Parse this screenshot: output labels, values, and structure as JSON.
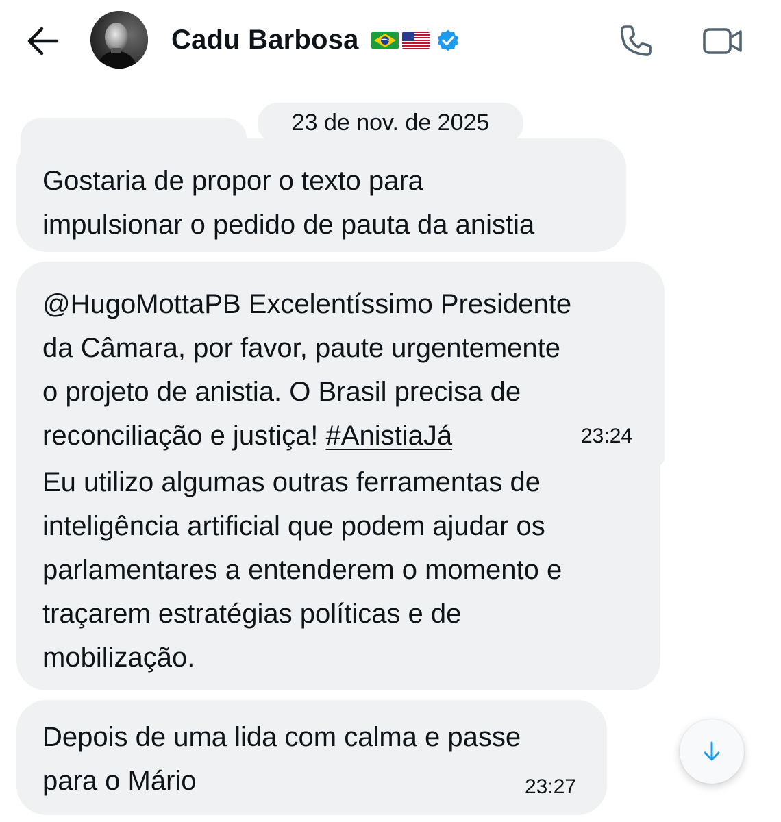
{
  "header": {
    "contact_name": "Cadu Barbosa",
    "flags": [
      "brazil-flag",
      "usa-flag"
    ],
    "verified_badge": "verified-icon",
    "icons": {
      "back": "arrow-left-icon",
      "call": "phone-icon",
      "video": "video-camera-icon"
    }
  },
  "conversation": {
    "date_separator": "23 de nov. de 2025",
    "messages": [
      {
        "lines": [
          "Gostaria de propor o texto para",
          "impulsionar o pedido de pauta da anistia"
        ]
      },
      {
        "mention": "@HugoMottaPB",
        "lines": [
          " Excelentíssimo Presidente",
          "da Câmara, por favor, paute urgentemente",
          "o projeto de anistia. O Brasil precisa de",
          "reconciliação e justiça! "
        ],
        "hashtag": "#AnistiaJá",
        "time": "23:24"
      },
      {
        "lines": [
          "Eu utilizo algumas outras ferramentas de",
          "inteligência artificial que podem ajudar os",
          "parlamentares a entenderem o momento e",
          "traçarem estratégias políticas e de",
          "mobilização."
        ]
      },
      {
        "lines": [
          "Depois de uma lida com calma e passe",
          "para o Mário"
        ],
        "time": "23:27"
      }
    ]
  },
  "scroll_button": {
    "icon": "arrow-down-icon"
  },
  "colors": {
    "bubble_bg": "#eff1f3",
    "text": "#0f1419",
    "accent": "#1d9bf0"
  }
}
